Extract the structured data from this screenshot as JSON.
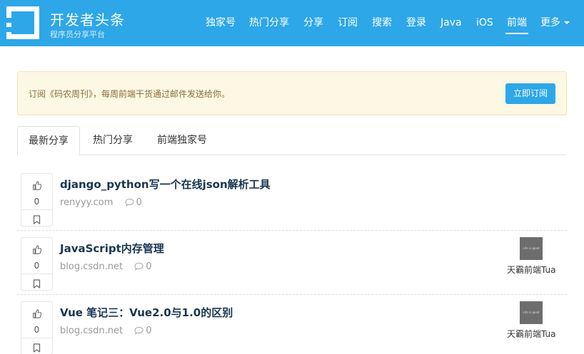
{
  "header": {
    "logo_icon": "square-frame-logo-icon",
    "title": "开发者头条",
    "subtitle": "程序员分享平台",
    "nav": [
      {
        "label": "独家号"
      },
      {
        "label": "热门分享"
      },
      {
        "label": "分享"
      },
      {
        "label": "订阅"
      },
      {
        "label": "搜索"
      },
      {
        "label": "登录"
      },
      {
        "label": "Java"
      },
      {
        "label": "iOS"
      },
      {
        "label": "前端",
        "active": true
      },
      {
        "label": "更多"
      }
    ],
    "brand_color": "#2da7e8"
  },
  "alert": {
    "text": "订阅《码农周刊》，每周前端干货通过邮件发送给你。",
    "button_label": "立即订阅"
  },
  "tabs": [
    {
      "label": "最新分享",
      "active": true
    },
    {
      "label": "热门分享"
    },
    {
      "label": "前端独家号"
    }
  ],
  "items": [
    {
      "title": "django_python写一个在线json解析工具",
      "source": "renyyy.com",
      "comments": "0",
      "votes": "0",
      "author": null
    },
    {
      "title": "JavaScript内存管理",
      "source": "blog.csdn.net",
      "comments": "0",
      "votes": "0",
      "author": {
        "name": "天霸前端Tua",
        "avatar_text": "Life is good"
      }
    },
    {
      "title": "Vue 笔记三：Vue2.0与1.0的区别",
      "source": "blog.csdn.net",
      "comments": "0",
      "votes": "0",
      "author": {
        "name": "天霸前端Tua",
        "avatar_text": "Life is good"
      }
    }
  ]
}
